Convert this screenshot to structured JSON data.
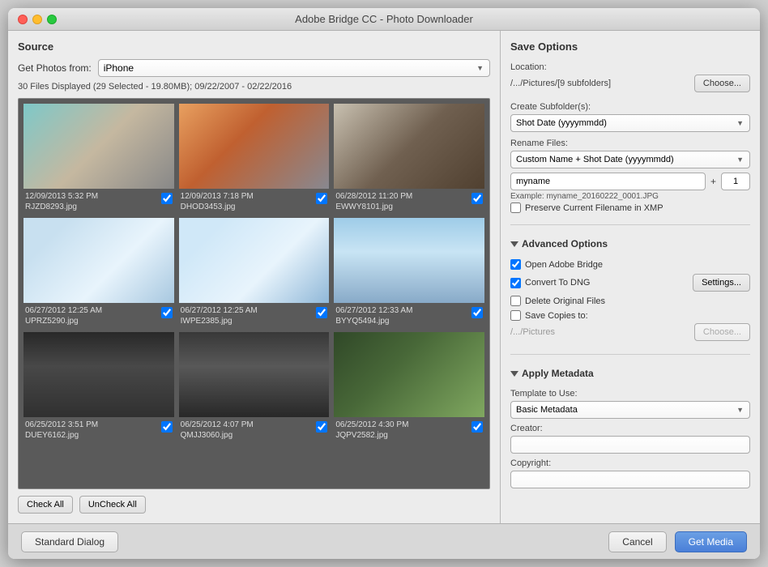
{
  "window": {
    "title": "Adobe Bridge CC - Photo Downloader"
  },
  "source": {
    "section_title": "Source",
    "get_photos_label": "Get Photos from:",
    "source_value": "iPhone",
    "file_info": "30 Files Displayed (29 Selected - 19.80MB); 09/22/2007 - 02/22/2016"
  },
  "photos": [
    {
      "date": "12/09/2013 5:32 PM",
      "filename": "RJZD8293.jpg",
      "checked": true,
      "thumb_class": "thumb-1"
    },
    {
      "date": "12/09/2013 7:18 PM",
      "filename": "DHOD3453.jpg",
      "checked": true,
      "thumb_class": "thumb-2"
    },
    {
      "date": "06/28/2012 11:20 PM",
      "filename": "EWWY8101.jpg",
      "checked": true,
      "thumb_class": "thumb-3"
    },
    {
      "date": "06/27/2012 12:25 AM",
      "filename": "UPRZ5290.jpg",
      "checked": true,
      "thumb_class": "thumb-4"
    },
    {
      "date": "06/27/2012 12:25 AM",
      "filename": "IWPE2385.jpg",
      "checked": true,
      "thumb_class": "thumb-5"
    },
    {
      "date": "06/27/2012 12:33 AM",
      "filename": "BYYQ5494.jpg",
      "checked": true,
      "thumb_class": "thumb-6"
    },
    {
      "date": "06/25/2012 3:51 PM",
      "filename": "DUEY6162.jpg",
      "checked": true,
      "thumb_class": "thumb-7"
    },
    {
      "date": "06/25/2012 4:07 PM",
      "filename": "QMJJ3060.jpg",
      "checked": true,
      "thumb_class": "thumb-8"
    },
    {
      "date": "06/25/2012 4:30 PM",
      "filename": "JQPV2582.jpg",
      "checked": true,
      "thumb_class": "thumb-9"
    }
  ],
  "bottom_buttons": {
    "check_all": "Check All",
    "uncheck_all": "UnCheck All"
  },
  "save_options": {
    "section_title": "Save Options",
    "location_label": "Location:",
    "location_path": "/.../Pictures/[9 subfolders]",
    "choose_label": "Choose...",
    "subfolder_label": "Create Subfolder(s):",
    "subfolder_value": "Shot Date (yyyymmdd)",
    "rename_label": "Rename Files:",
    "rename_value": "Custom Name + Shot Date (yyyymmdd)",
    "custom_name_value": "myname",
    "plus_label": "+",
    "counter_value": "1",
    "example_label": "Example: myname_20160222_0001.JPG",
    "preserve_filename_label": "Preserve Current Filename in XMP"
  },
  "advanced_options": {
    "section_title": "Advanced Options",
    "open_bridge_label": "Open Adobe Bridge",
    "open_bridge_checked": true,
    "convert_dng_label": "Convert To DNG",
    "convert_dng_checked": true,
    "settings_label": "Settings...",
    "delete_originals_label": "Delete Original Files",
    "delete_originals_checked": false,
    "save_copies_label": "Save Copies to:",
    "save_copies_checked": false,
    "copies_path": "/.../Pictures",
    "copies_choose_label": "Choose..."
  },
  "apply_metadata": {
    "section_title": "Apply Metadata",
    "template_label": "Template to Use:",
    "template_value": "Basic Metadata",
    "creator_label": "Creator:",
    "creator_value": "",
    "copyright_label": "Copyright:",
    "copyright_value": ""
  },
  "footer": {
    "standard_dialog_label": "Standard Dialog",
    "cancel_label": "Cancel",
    "get_media_label": "Get Media"
  }
}
